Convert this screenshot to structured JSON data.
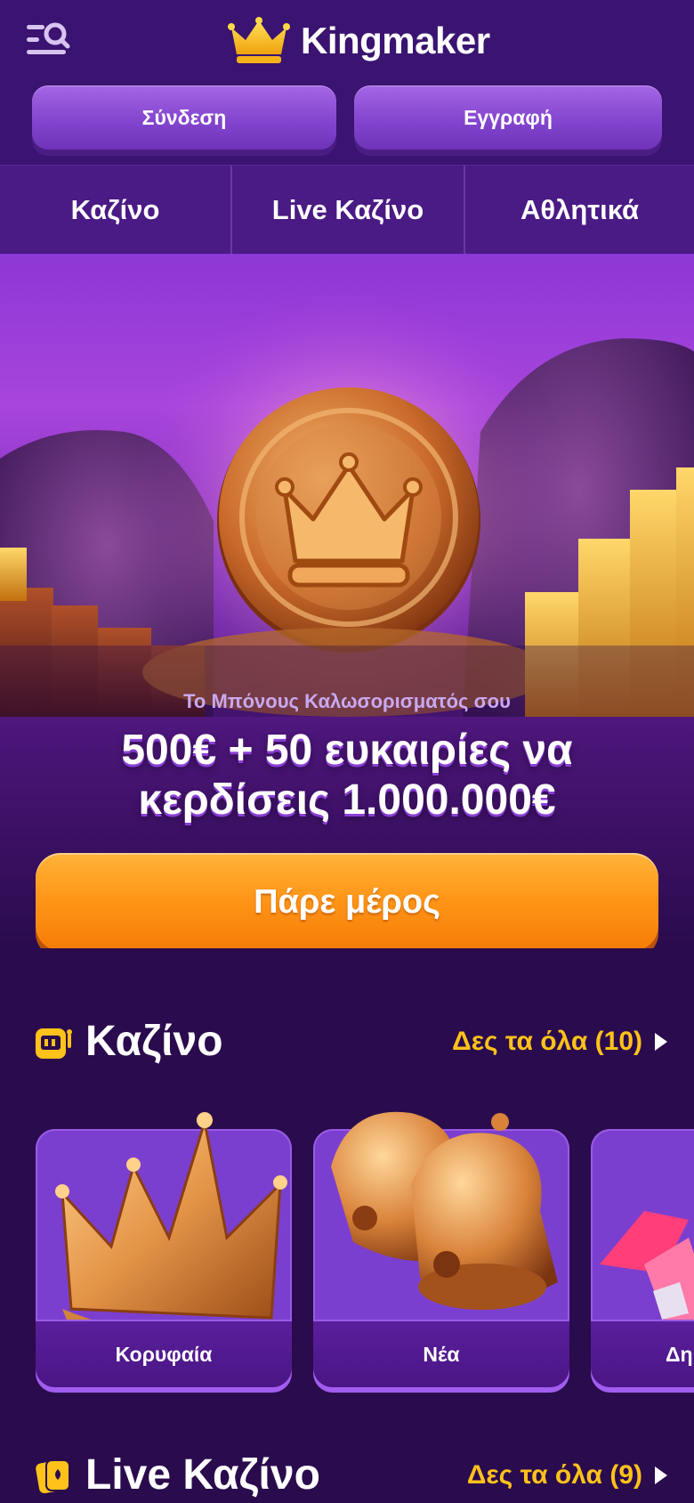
{
  "header": {
    "brand": "Kingmaker",
    "login_label": "Σύνδεση",
    "register_label": "Εγγραφή"
  },
  "nav": {
    "items": [
      {
        "label": "Καζίνο"
      },
      {
        "label": "Live Καζίνο"
      },
      {
        "label": "Αθλητικά"
      }
    ]
  },
  "promo": {
    "subtitle": "Το Μπόνους Καλωσορισματός σου",
    "title_line1": "500€ + 50 ευκαιρίες να",
    "title_line2": "κερδίσεις 1.000.000€",
    "cta_label": "Πάρε μέρος"
  },
  "casino_section": {
    "title": "Καζίνο",
    "see_all": "Δες τα όλα (10)",
    "categories": [
      {
        "label": "Κορυφαία",
        "icon": "crown-icon"
      },
      {
        "label": "Νέα",
        "icon": "bells-icon"
      },
      {
        "label": "Δη",
        "icon": "rocket-icon"
      }
    ]
  },
  "live_section": {
    "title": "Live Καζίνο",
    "see_all": "Δες τα όλα (9)"
  },
  "colors": {
    "background": "#2a0b4d",
    "header": "#3a1470",
    "accent_orange": "#ff9416",
    "see_all_yellow": "#ffc21a",
    "button_purple": "#8445cf"
  }
}
